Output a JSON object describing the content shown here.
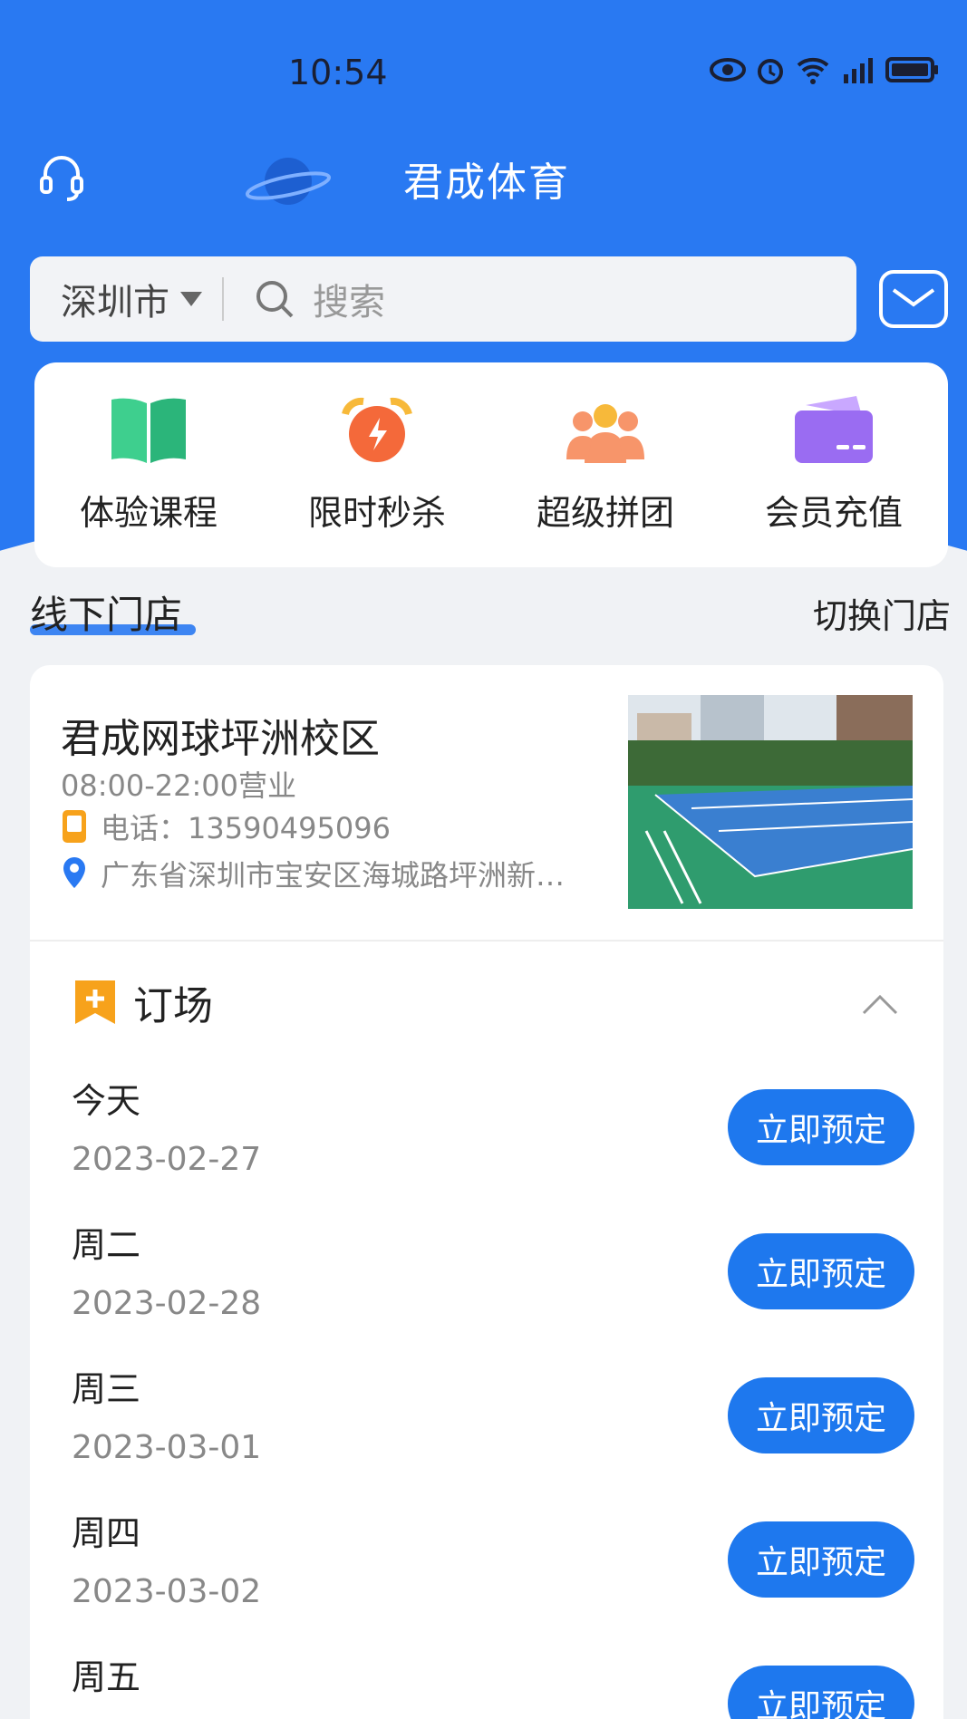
{
  "status_bar": {
    "time": "10:54"
  },
  "header": {
    "title": "君成体育"
  },
  "search": {
    "city": "深圳市",
    "placeholder": "搜索"
  },
  "menu": [
    {
      "label": "体验课程",
      "icon": "book-icon",
      "color": "#3ecf8e"
    },
    {
      "label": "限时秒杀",
      "icon": "alarm-clock-icon",
      "color": "#f4693a"
    },
    {
      "label": "超级拼团",
      "icon": "group-icon",
      "color": "#f7956a"
    },
    {
      "label": "会员充值",
      "icon": "card-icon",
      "color": "#9a6cf2"
    }
  ],
  "section": {
    "title": "线下门店",
    "action": "切换门店"
  },
  "store": {
    "name": "君成网球坪洲校区",
    "hours": "08:00-22:00营业",
    "phone": "电话：13590495096",
    "address": "广东省深圳市宝安区海城路坪洲新…"
  },
  "booking": {
    "title": "订场",
    "button_label": "立即预定",
    "days": [
      {
        "name": "今天",
        "date": "2023-02-27"
      },
      {
        "name": "周二",
        "date": "2023-02-28"
      },
      {
        "name": "周三",
        "date": "2023-03-01"
      },
      {
        "name": "周四",
        "date": "2023-03-02"
      },
      {
        "name": "周五",
        "date": ""
      }
    ]
  },
  "colors": {
    "primary": "#2979f2",
    "button": "#1e78ee"
  }
}
